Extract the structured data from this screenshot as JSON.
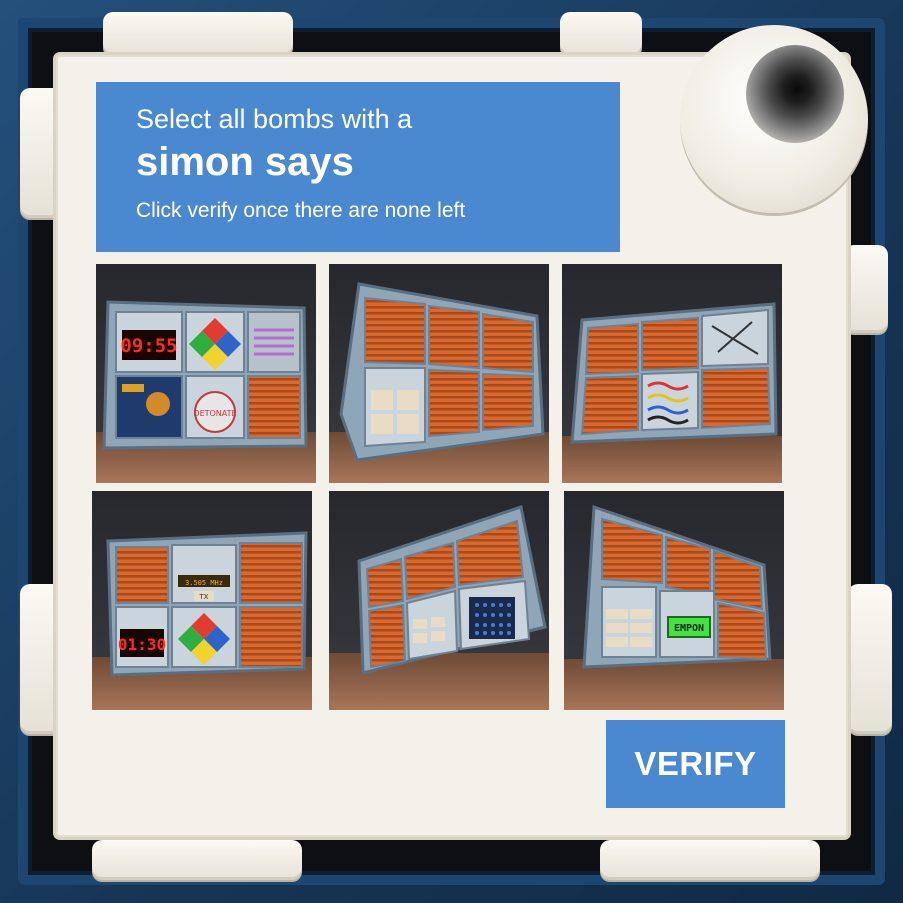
{
  "prompt": {
    "line1": "Select all bombs with a",
    "target": "simon says",
    "line3": "Click verify once there are none left"
  },
  "tiles": [
    {
      "timer": "09:55",
      "button_label": "DETONATE",
      "has_simon": true
    },
    {
      "has_simon": false
    },
    {
      "has_simon": false
    },
    {
      "timer": "01:30",
      "freq": "3.505 MHz",
      "freq_button": "TX",
      "has_simon": true
    },
    {
      "has_simon": false
    },
    {
      "display": "EMPON",
      "has_simon": false
    }
  ],
  "verify_label": "VERIFY",
  "colors": {
    "accent": "#4a88cf",
    "card": "#f3f1ea",
    "frame": "#1b3e63"
  }
}
